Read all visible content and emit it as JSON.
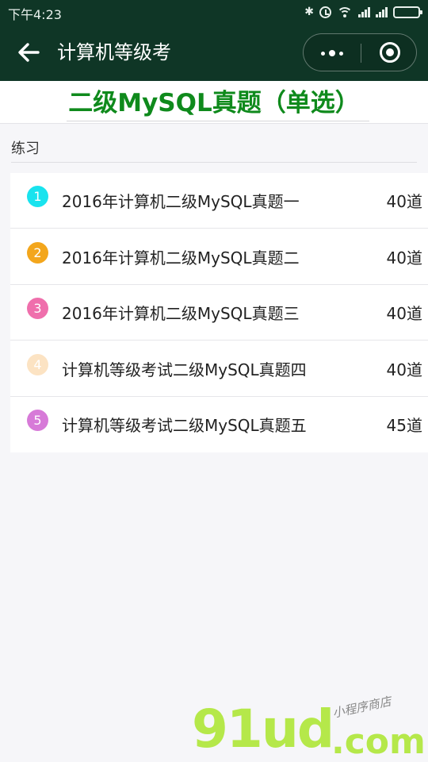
{
  "status_bar": {
    "time": "下午4:23",
    "bluetooth_glyph": "✱"
  },
  "nav": {
    "title": "计算机等级考"
  },
  "page": {
    "title": "二级MySQL真题（单选）"
  },
  "section": {
    "label": "练习"
  },
  "items": [
    {
      "number": "1",
      "title": "2016年计算机二级MySQL真题一",
      "count": "40道",
      "badge_color": "#19e3ee"
    },
    {
      "number": "2",
      "title": "2016年计算机二级MySQL真题二",
      "count": "40道",
      "badge_color": "#f3a61c"
    },
    {
      "number": "3",
      "title": "2016年计算机二级MySQL真题三",
      "count": "40道",
      "badge_color": "#ef6fac"
    },
    {
      "number": "4",
      "title": "计算机等级考试二级MySQL真题四",
      "count": "40道",
      "badge_color": "#fce3c3"
    },
    {
      "number": "5",
      "title": "计算机等级考试二级MySQL真题五",
      "count": "45道",
      "badge_color": "#d77ad8"
    }
  ],
  "watermark": {
    "main": "91ud",
    "domain": ".com",
    "sub": "小程序商店"
  },
  "colors": {
    "nav_bg": "#0f3626",
    "title_green": "#0f8a1c",
    "watermark_green": "#b5e84a"
  }
}
